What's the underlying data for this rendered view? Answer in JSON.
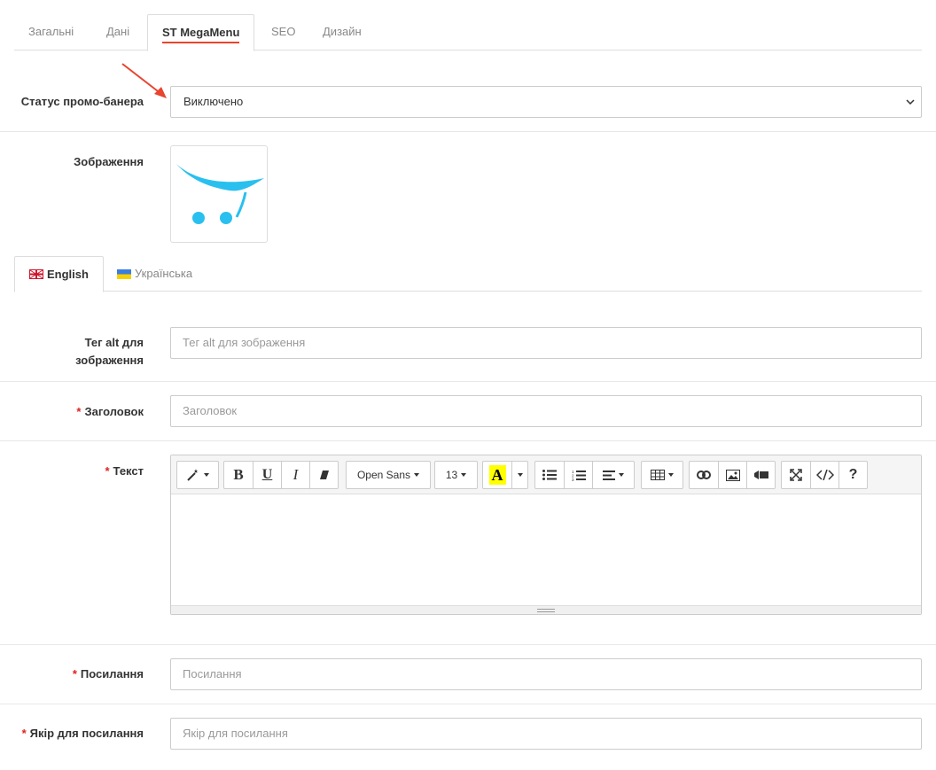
{
  "top_tabs": [
    {
      "label": "Загальні"
    },
    {
      "label": "Дані"
    },
    {
      "label": "ST MegaMenu"
    },
    {
      "label": "SEO"
    },
    {
      "label": "Дизайн"
    }
  ],
  "promo_status": {
    "label": "Статус промо-банера",
    "value": "Виключено"
  },
  "image": {
    "label": "Зображення"
  },
  "language_tabs": [
    {
      "label": "English"
    },
    {
      "label": "Українська"
    }
  ],
  "alt_tag": {
    "label_line1": "Тег alt для",
    "label_line2": "зображення",
    "placeholder": "Тег alt для зображення"
  },
  "heading": {
    "required_mark": "*",
    "label": "Заголовок",
    "placeholder": "Заголовок"
  },
  "text": {
    "required_mark": "*",
    "label": "Текст",
    "toolbar": {
      "font_family": "Open Sans",
      "font_size": "13",
      "bold": "B",
      "underline": "U",
      "italic": "I",
      "color_letter": "A",
      "help": "?"
    }
  },
  "link": {
    "required_mark": "*",
    "label": "Посилання",
    "placeholder": "Посилання"
  },
  "anchor": {
    "required_mark": "*",
    "label": "Якір для посилання",
    "placeholder": "Якір для посилання"
  },
  "colors": {
    "accent_underline": "#e8442e",
    "required": "#e02020",
    "arrow": "#e8442e",
    "logo_blue": "#29c0ef",
    "highlight": "#ffff00"
  }
}
